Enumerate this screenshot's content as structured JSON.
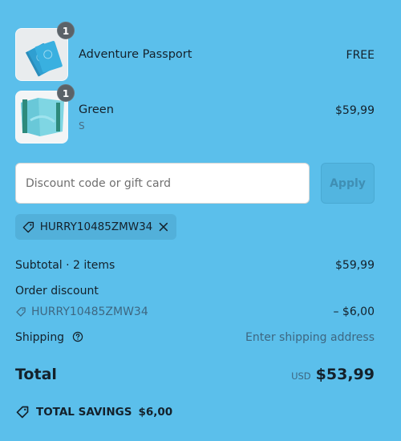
{
  "items": [
    {
      "title": "Adventure Passport",
      "variant": "",
      "price": "FREE",
      "quantity": "1"
    },
    {
      "title": "Green",
      "variant": "S",
      "price": "$59,99",
      "quantity": "1"
    }
  ],
  "discount": {
    "placeholder": "Discount code or gift card",
    "apply_label": "Apply",
    "applied_code": "HURRY10485ZMW34"
  },
  "summary": {
    "subtotal_label": "Subtotal · 2 items",
    "subtotal_value": "$59,99",
    "order_discount_label": "Order discount",
    "discount_code": "HURRY10485ZMW34",
    "discount_value": "– $6,00",
    "shipping_label": "Shipping",
    "shipping_value": "Enter shipping address",
    "total_label": "Total",
    "currency": "USD",
    "total_value": "$53,99",
    "savings_label": "TOTAL SAVINGS",
    "savings_value": "$6,00"
  },
  "colors": {
    "background": "#5bbfeb",
    "text": "#14212b",
    "muted": "#3e6781"
  }
}
